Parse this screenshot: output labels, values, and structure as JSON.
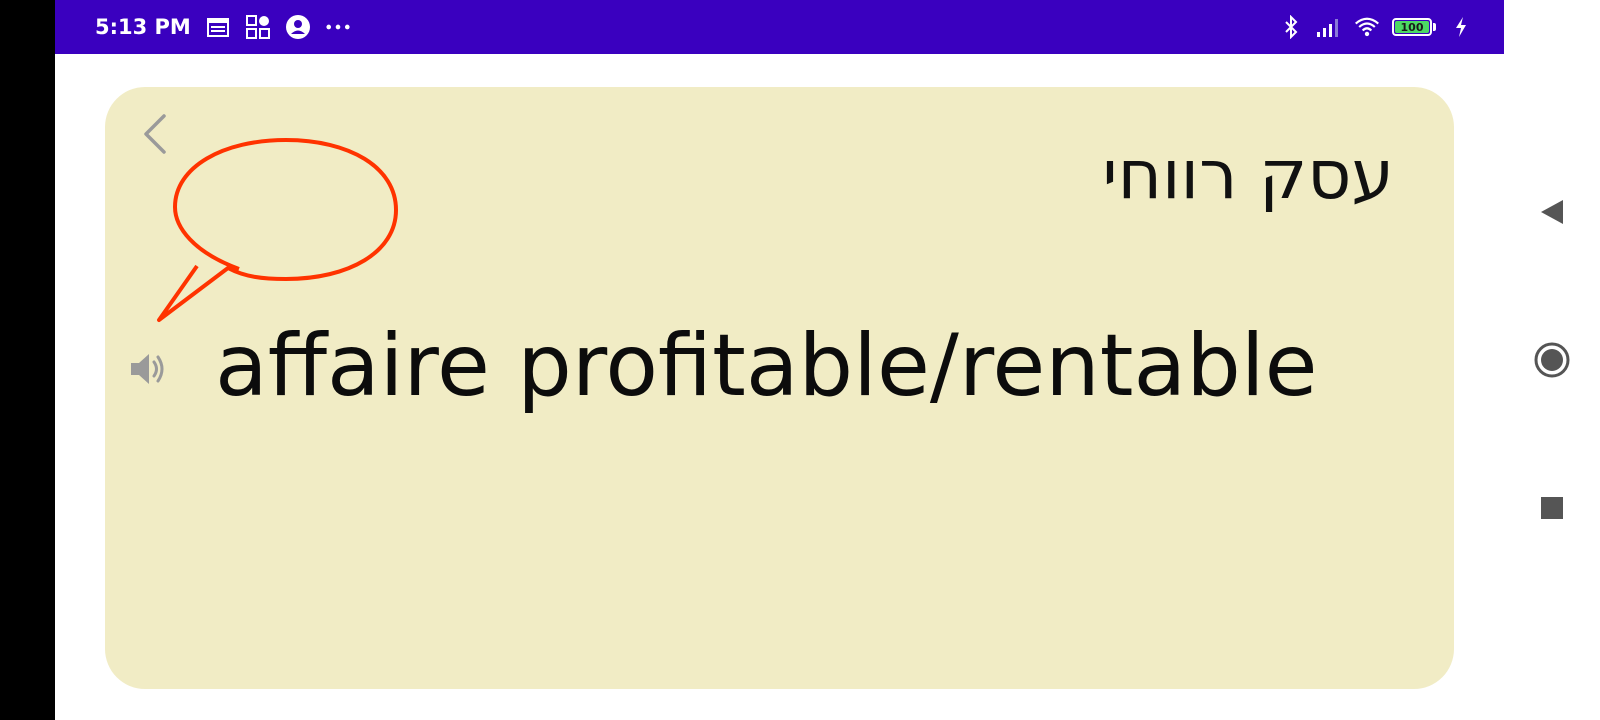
{
  "status_bar": {
    "time": "5:13 PM",
    "battery_level": "100",
    "background_color": "#3a00bf",
    "left_icons": [
      "calendar-icon",
      "widgets-icon",
      "account-icon",
      "more-dots-icon"
    ],
    "right_icons": [
      "bluetooth-icon",
      "signal-icon",
      "wifi-icon",
      "battery-icon",
      "charging-icon"
    ]
  },
  "card": {
    "background_color": "#f1ecc5",
    "hebrew_text": "עסק רווחי",
    "french_text": "affaire profitable/rentable",
    "bubble_color": "#ff3300"
  },
  "nav": {
    "buttons": [
      "back-triangle-icon",
      "home-circle-icon",
      "recents-square-icon"
    ]
  }
}
